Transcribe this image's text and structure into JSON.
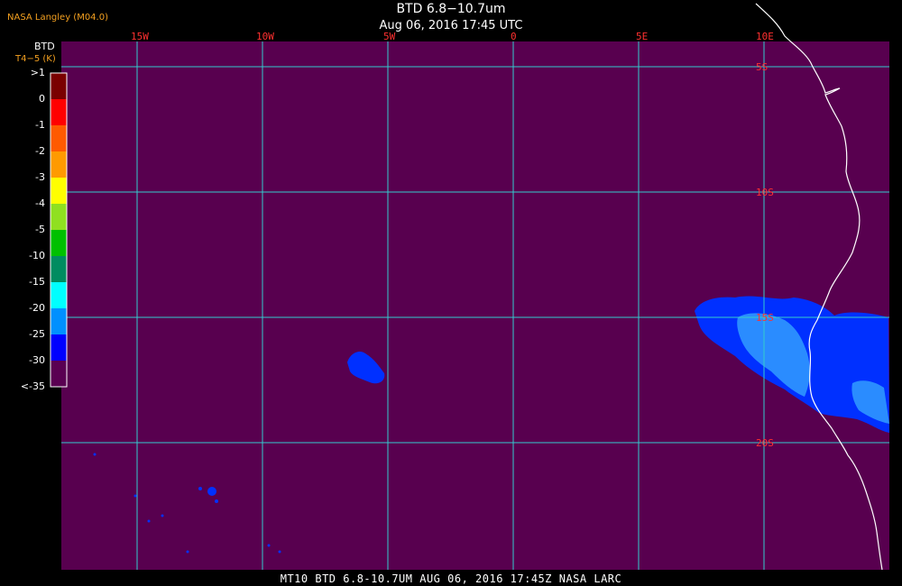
{
  "header": {
    "credit": "NASA Langley (M04.0)",
    "title": "BTD 6.8−10.7um",
    "subtitle": "Aug 06, 2016 17:45 UTC"
  },
  "footer": {
    "banner": "MT10  BTD 6.8-10.7UM   AUG 06, 2016 17:45Z   NASA LARC"
  },
  "legend": {
    "title": "BTD",
    "units": "T4−5 (K)",
    "labels": [
      ">1",
      "0",
      "-1",
      "-2",
      "-3",
      "-4",
      "-5",
      "-10",
      "-15",
      "-20",
      "-25",
      "-30",
      "<-35"
    ],
    "colors": [
      "#7a0000",
      "#ff0000",
      "#ff5a00",
      "#ff9a00",
      "#ffff00",
      "#90e020",
      "#00c000",
      "#008c60",
      "#00ffff",
      "#0090ff",
      "#0000ff",
      "#5a0052"
    ]
  },
  "grid": {
    "lon_labels": [
      "15W",
      "10W",
      "5W",
      "0",
      "5E",
      "10E"
    ],
    "lat_labels": [
      "5S",
      "10S",
      "15S",
      "20S"
    ],
    "line_color": "#33cccc",
    "label_color": "#ff3030"
  },
  "colors": {
    "background": "#58004f",
    "cloud_blue": "#0030ff",
    "cloud_light": "#2a8cff",
    "coast": "#ffffff"
  }
}
